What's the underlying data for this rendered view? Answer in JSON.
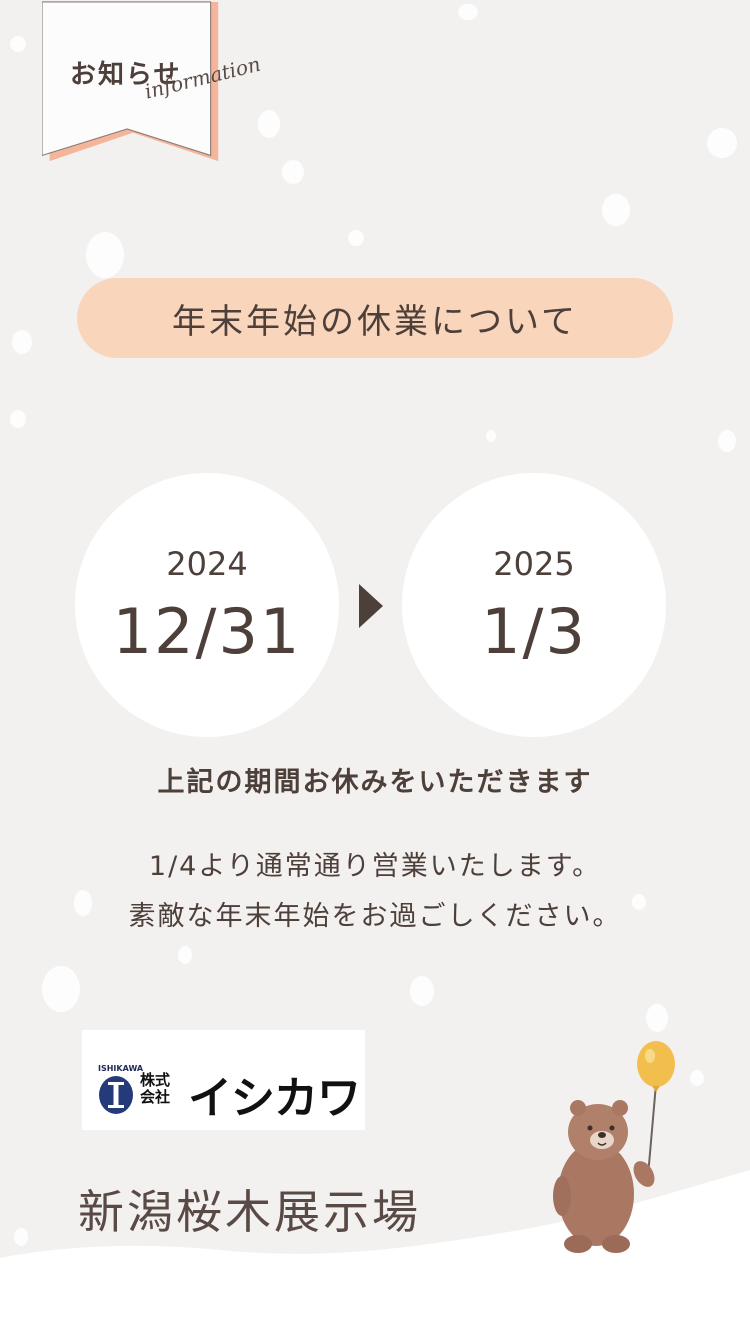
{
  "tag": {
    "title": "お知らせ",
    "subtitle": "information"
  },
  "heading": "年末年始の休業について",
  "period": {
    "start": {
      "year": "2024",
      "date": "12/31"
    },
    "end": {
      "year": "2025",
      "date": "1/3"
    }
  },
  "notice_bold": "上記の期間お休みをいただきます",
  "notice_lines": [
    "1/4より通常通り営業いたします。",
    "素敵な年末年始をお過ごしください。"
  ],
  "logo": {
    "small": "ISHIKAWA",
    "kaisha_line1": "株式",
    "kaisha_line2": "会社",
    "name": "イシカワ"
  },
  "venue": "新潟桜木展示場",
  "colors": {
    "background": "#f3f1f0",
    "accent": "#f8d5bb",
    "tag_stripe": "#f4b59a",
    "text": "#4d3f3a"
  }
}
